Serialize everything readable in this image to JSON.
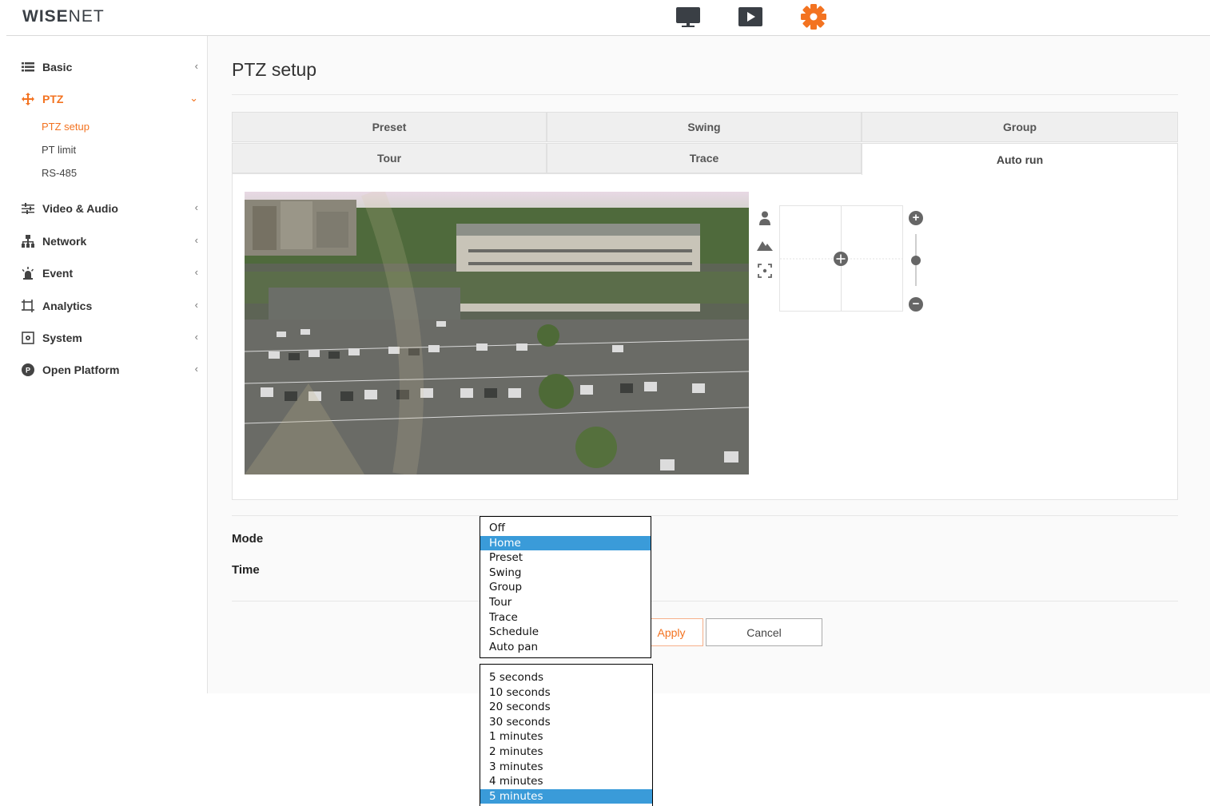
{
  "header": {
    "logo_text_bold": "WISE",
    "logo_text_thin": "NET",
    "icons": [
      "monitor-icon",
      "playback-icon",
      "settings-gear-icon"
    ],
    "accent_color": "#f37321"
  },
  "sidebar": {
    "items": [
      {
        "label": "Basic",
        "icon": "list-icon"
      },
      {
        "label": "PTZ",
        "icon": "ptz-move-icon"
      },
      {
        "label": "Video & Audio",
        "icon": "sliders-icon"
      },
      {
        "label": "Network",
        "icon": "network-icon"
      },
      {
        "label": "Event",
        "icon": "event-alarm-icon"
      },
      {
        "label": "Analytics",
        "icon": "analytics-icon"
      },
      {
        "label": "System",
        "icon": "system-icon"
      },
      {
        "label": "Open Platform",
        "icon": "open-platform-icon"
      }
    ],
    "ptz_sub": [
      "PTZ setup",
      "PT limit",
      "RS-485"
    ]
  },
  "main": {
    "title": "PTZ setup",
    "tabs": [
      "Preset",
      "Swing",
      "Group",
      "Tour",
      "Trace",
      "Auto run"
    ],
    "active_tab": "Auto run",
    "mode_label": "Mode",
    "time_label": "Time",
    "apply_label": "Apply",
    "cancel_label": "Cancel"
  },
  "mode_dropdown": {
    "options": [
      "Off",
      "Home",
      "Preset",
      "Swing",
      "Group",
      "Tour",
      "Trace",
      "Schedule",
      "Auto pan"
    ],
    "selected": "Home"
  },
  "time_dropdown": {
    "options": [
      "5 seconds",
      "10 seconds",
      "20 seconds",
      "30 seconds",
      "1 minutes",
      "2 minutes",
      "3 minutes",
      "4 minutes",
      "5 minutes"
    ],
    "selected": "5 minutes"
  }
}
